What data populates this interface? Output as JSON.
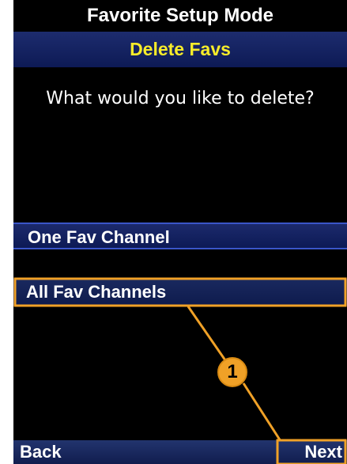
{
  "header": {
    "title": "Favorite Setup Mode",
    "subtitle": "Delete Favs"
  },
  "main": {
    "prompt": "What would you like to delete?",
    "options": [
      {
        "label": "One Fav Channel",
        "selected": false
      },
      {
        "label": "All Fav Channels",
        "selected": true
      }
    ]
  },
  "softkeys": {
    "left_label": "Back",
    "right_label": "Next"
  },
  "annotation": {
    "callout_number": "1",
    "callout_color": "#f0a127"
  },
  "colors": {
    "screen_background": "#000000",
    "bar_blue": "#1d2c6e",
    "subtitle_text": "#f7ec2a",
    "highlight_outline": "#f0a127"
  }
}
